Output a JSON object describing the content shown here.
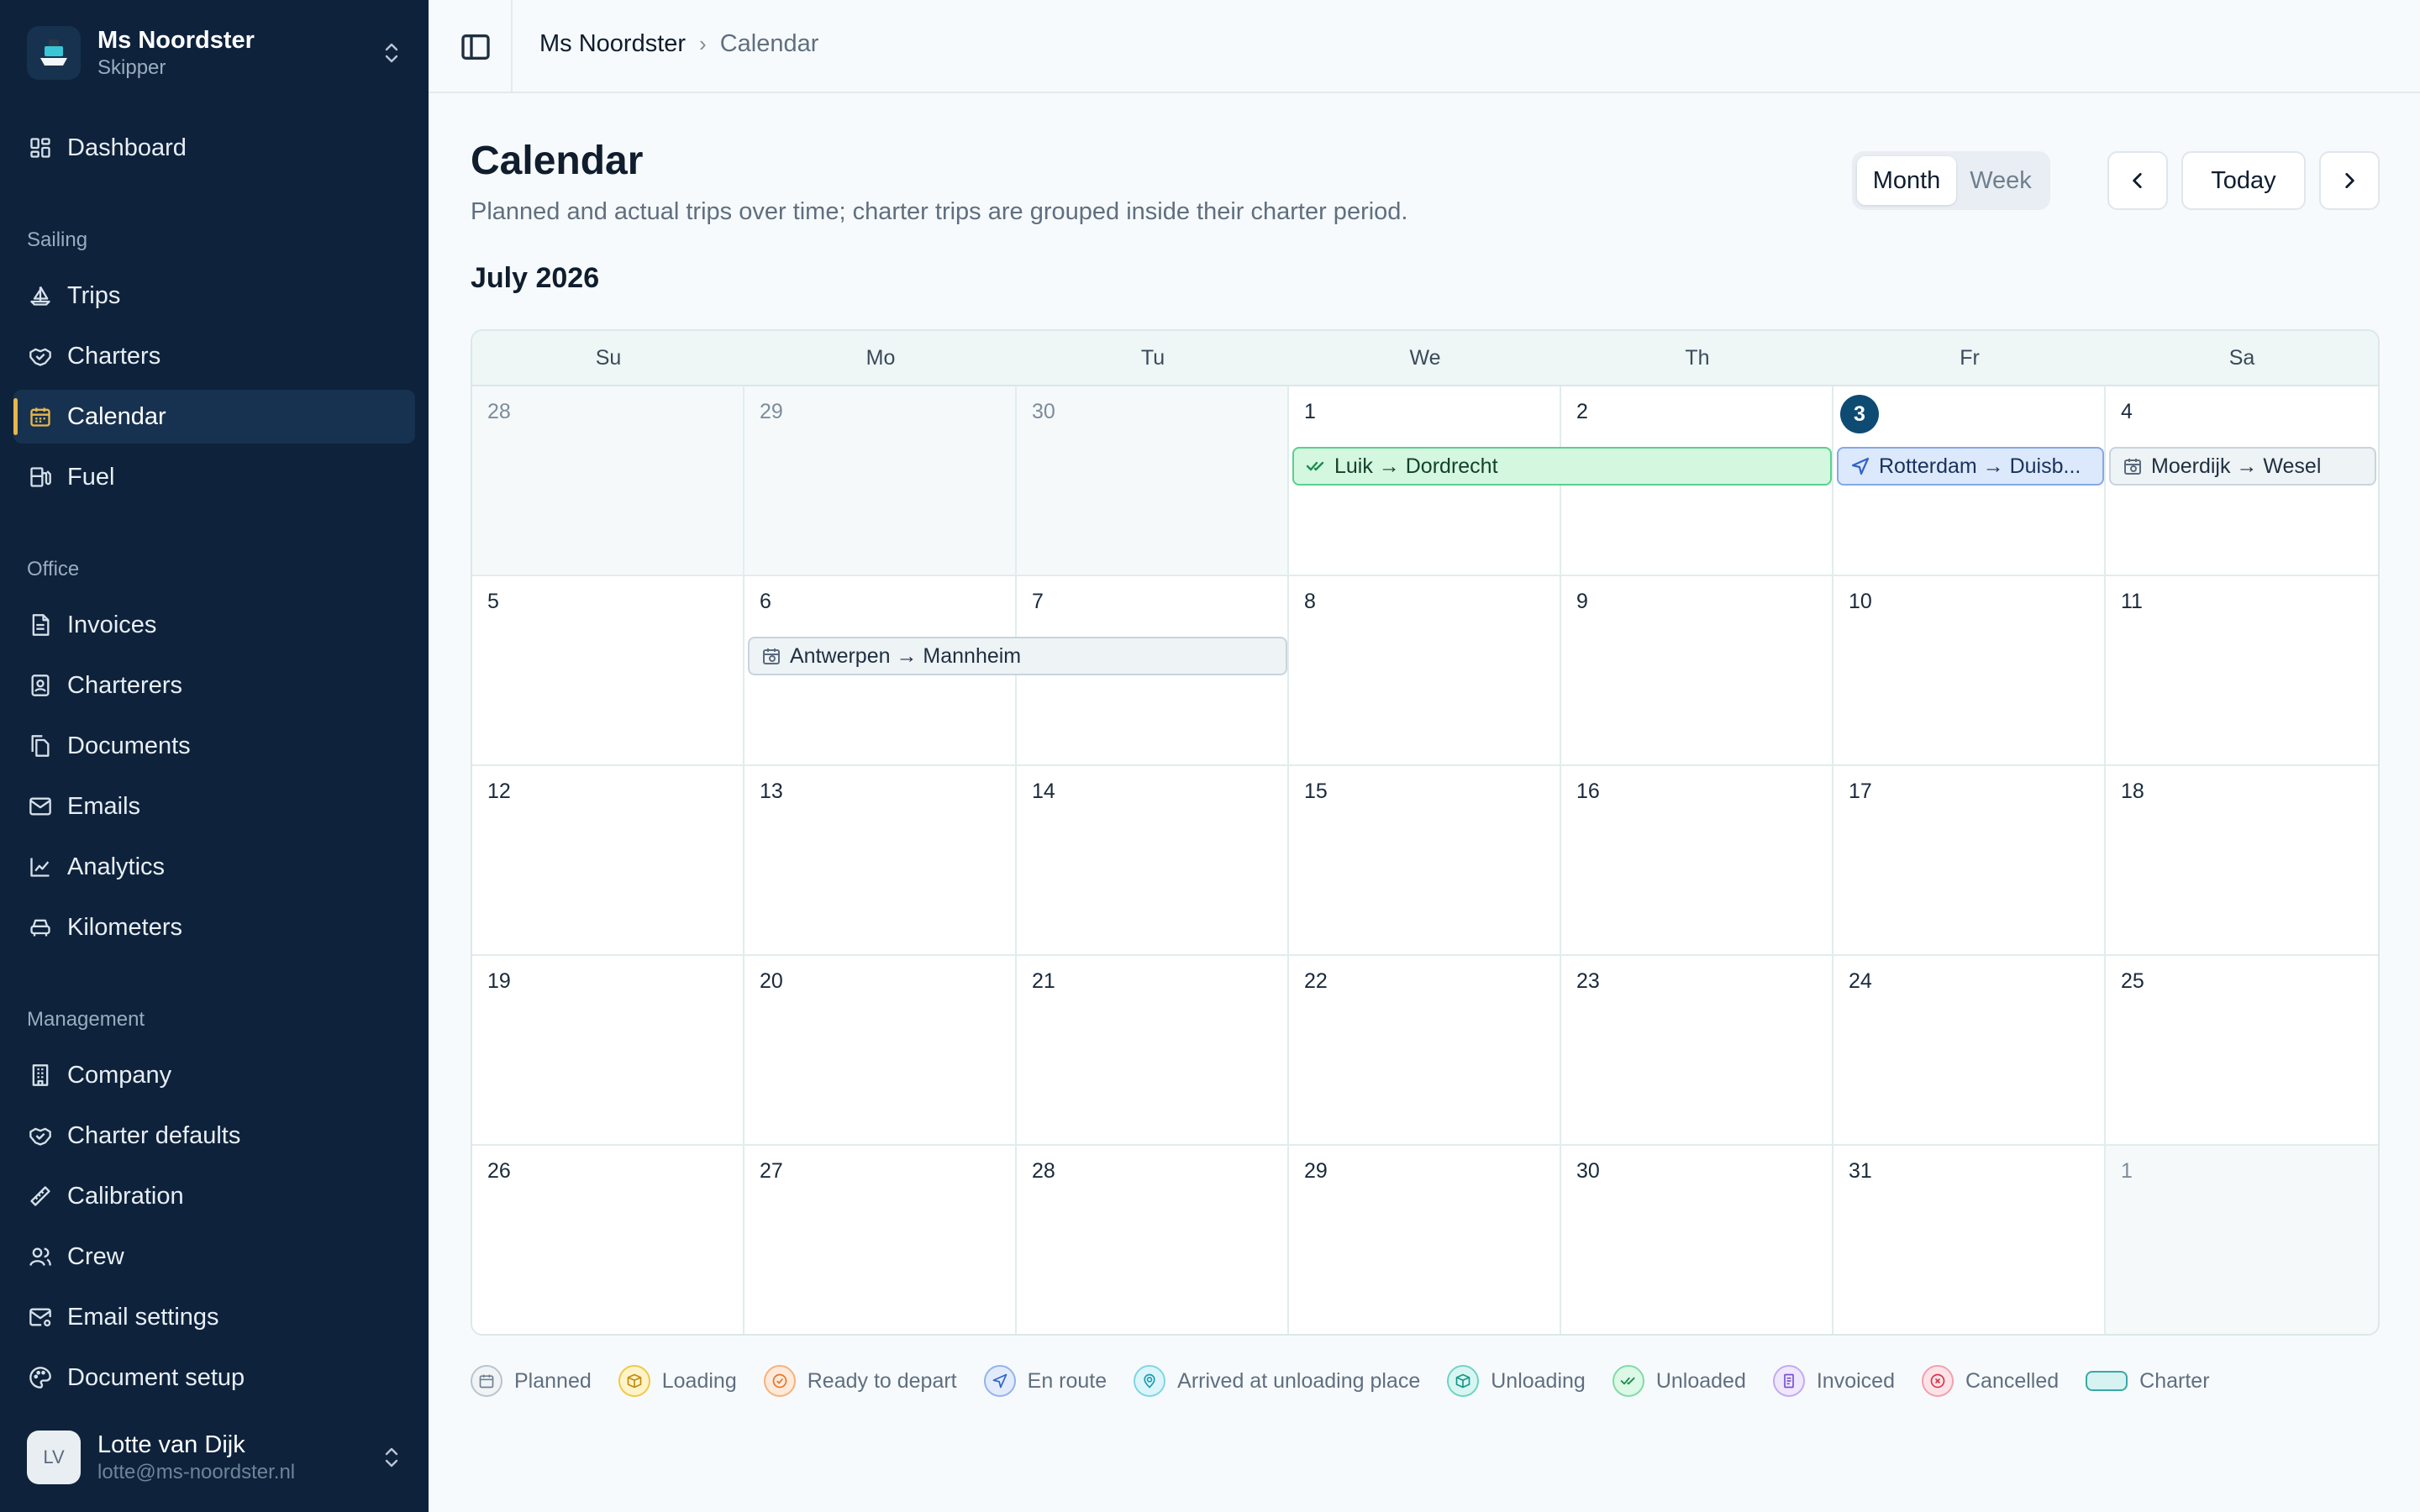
{
  "org": {
    "name": "Ms Noordster",
    "role": "Skipper"
  },
  "nav": {
    "top": [
      {
        "label": "Dashboard"
      }
    ],
    "sailing_label": "Sailing",
    "sailing": [
      {
        "label": "Trips"
      },
      {
        "label": "Charters"
      },
      {
        "label": "Calendar"
      },
      {
        "label": "Fuel"
      }
    ],
    "office_label": "Office",
    "office": [
      {
        "label": "Invoices"
      },
      {
        "label": "Charterers"
      },
      {
        "label": "Documents"
      },
      {
        "label": "Emails"
      },
      {
        "label": "Analytics"
      },
      {
        "label": "Kilometers"
      }
    ],
    "management_label": "Management",
    "management": [
      {
        "label": "Company"
      },
      {
        "label": "Charter defaults"
      },
      {
        "label": "Calibration"
      },
      {
        "label": "Crew"
      },
      {
        "label": "Email settings"
      },
      {
        "label": "Document setup"
      }
    ]
  },
  "user": {
    "initials": "LV",
    "name": "Lotte van Dijk",
    "email": "lotte@ms-noordster.nl"
  },
  "breadcrumb": {
    "root": "Ms Noordster",
    "current": "Calendar"
  },
  "page": {
    "title": "Calendar",
    "subtitle": "Planned and actual trips over time; charter trips are grouped inside their charter period.",
    "month_label": "July 2026"
  },
  "view_toggle": {
    "month": "Month",
    "week": "Week",
    "selected": "Month"
  },
  "buttons": {
    "today": "Today"
  },
  "calendar": {
    "weekdays": [
      "Su",
      "Mo",
      "Tu",
      "We",
      "Th",
      "Fr",
      "Sa"
    ],
    "weeks": [
      [
        "28",
        "29",
        "30",
        "1",
        "2",
        "3",
        "4"
      ],
      [
        "5",
        "6",
        "7",
        "8",
        "9",
        "10",
        "11"
      ],
      [
        "12",
        "13",
        "14",
        "15",
        "16",
        "17",
        "18"
      ],
      [
        "19",
        "20",
        "21",
        "22",
        "23",
        "24",
        "25"
      ],
      [
        "26",
        "27",
        "28",
        "29",
        "30",
        "31",
        "1"
      ]
    ],
    "today": "3",
    "events": [
      {
        "label": "Luik → Dordrecht",
        "status": "Unloaded"
      },
      {
        "label": "Rotterdam → Duisb...",
        "status": "En route"
      },
      {
        "label": "Moerdijk → Wesel",
        "status": "Planned"
      },
      {
        "label": "Antwerpen → Mannheim",
        "status": "Planned"
      }
    ]
  },
  "legend": [
    {
      "label": "Planned",
      "color": "#7d8c9c"
    },
    {
      "label": "Loading",
      "color": "#e0a21a"
    },
    {
      "label": "Ready to depart",
      "color": "#f08a3c"
    },
    {
      "label": "En route",
      "color": "#3b73d9"
    },
    {
      "label": "Arrived at unloading place",
      "color": "#1fb0c8"
    },
    {
      "label": "Unloading",
      "color": "#19a99a"
    },
    {
      "label": "Unloaded",
      "color": "#2fb86a"
    },
    {
      "label": "Invoiced",
      "color": "#8b5fd6"
    },
    {
      "label": "Cancelled",
      "color": "#e0455c"
    },
    {
      "label": "Charter",
      "color": "#3aa8a8"
    }
  ]
}
